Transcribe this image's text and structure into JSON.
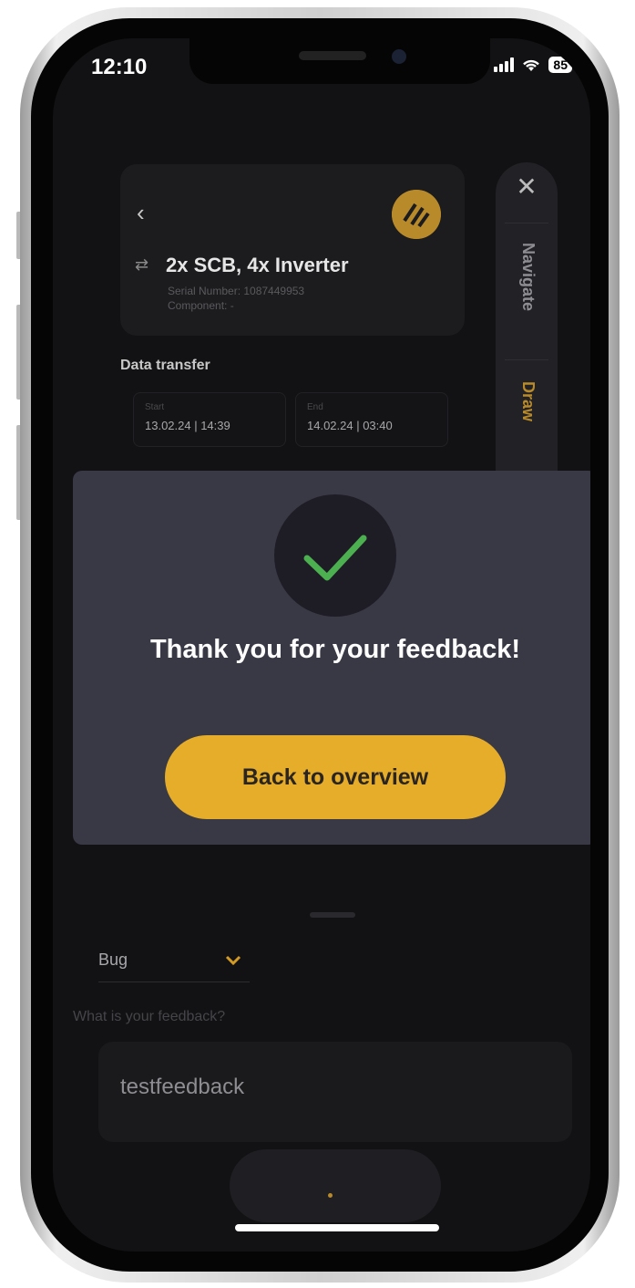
{
  "status_bar": {
    "time": "12:10",
    "battery": "85"
  },
  "device_card": {
    "title": "2x SCB, 4x Inverter",
    "serial": "Serial Number: 1087449953",
    "component": "Component: -"
  },
  "data_transfer": {
    "title": "Data transfer",
    "start_label": "Start",
    "start_value": "13.02.24 | 14:39",
    "end_label": "End",
    "end_value": "14.02.24 | 03:40"
  },
  "side_panel": {
    "navigate_label": "Navigate",
    "draw_label": "Draw"
  },
  "feedback_form": {
    "category": "Bug",
    "question": "What is your feedback?",
    "text": "testfeedback"
  },
  "modal": {
    "title": "Thank you for your feedback!",
    "button_label": "Back to overview"
  },
  "colors": {
    "accent": "#e6ad2a",
    "modal_bg": "#393845",
    "check": "#4caf50"
  }
}
